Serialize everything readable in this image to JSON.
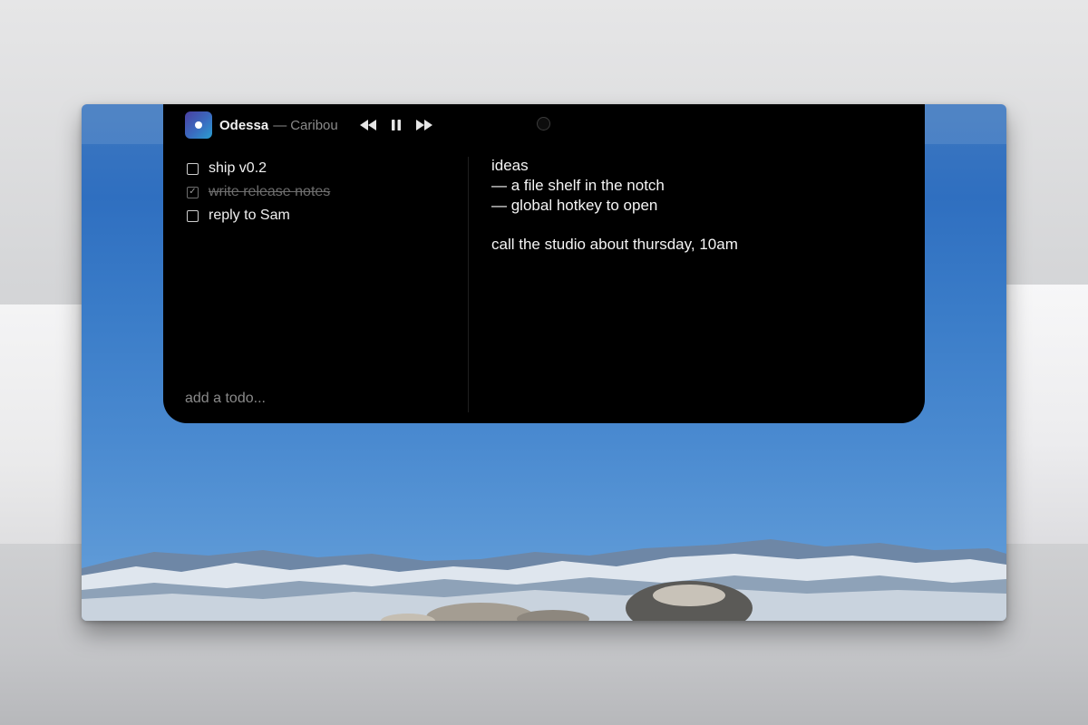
{
  "media": {
    "title": "Odessa",
    "separator": "—",
    "artist": "Caribou"
  },
  "controls": {
    "previous": "rewind-icon",
    "playpause": "pause-icon",
    "next": "fast-forward-icon"
  },
  "todos": {
    "items": [
      {
        "label": "ship v0.2",
        "done": false
      },
      {
        "label": "write release notes",
        "done": true
      },
      {
        "label": "reply to Sam",
        "done": false
      }
    ],
    "add_placeholder": "add a todo..."
  },
  "notes": {
    "lines": [
      "ideas",
      "— a file shelf in the notch",
      "— global hotkey to open",
      "call the studio about thursday, 10am"
    ]
  },
  "colors": {
    "panel": "#000000",
    "wallpaper_sky": "#3a7cc8",
    "muted_text": "#8a8a8a"
  }
}
